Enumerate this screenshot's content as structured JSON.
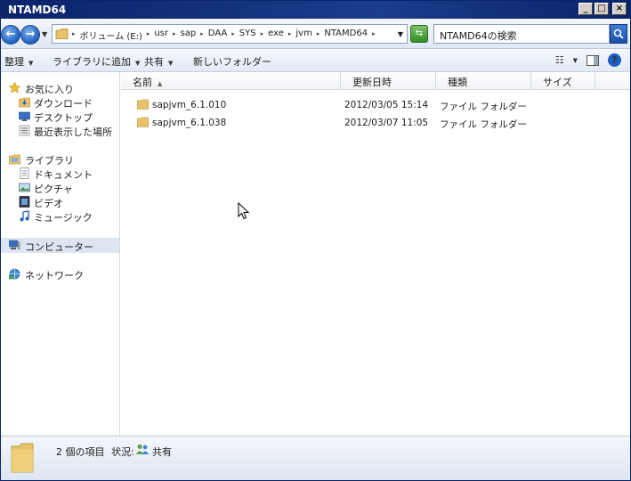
{
  "window": {
    "title": "NTAMD64",
    "minimize": "_",
    "maximize": "□",
    "close": "×"
  },
  "address": {
    "crumbs": [
      "ボリューム (E:)",
      "usr",
      "sap",
      "DAA",
      "SYS",
      "exe",
      "jvm",
      "NTAMD64"
    ],
    "search_value": "NTAMD64の検索"
  },
  "toolbar": {
    "organize": "整理",
    "add_to_library": "ライブラリに追加",
    "share": "共有",
    "new_folder": "新しいフォルダー"
  },
  "sidebar": {
    "favorites": "お気に入り",
    "downloads": "ダウンロード",
    "desktop": "デスクトップ",
    "recent": "最近表示した場所",
    "libraries": "ライブラリ",
    "documents": "ドキュメント",
    "pictures": "ピクチャ",
    "videos": "ビデオ",
    "music": "ミュージック",
    "computer": "コンピューター",
    "network": "ネットワーク"
  },
  "columns": {
    "name": "名前",
    "modified": "更新日時",
    "type": "種類",
    "size": "サイズ"
  },
  "files": [
    {
      "name": "sapjvm_6.1.010",
      "modified": "2012/03/05 15:14",
      "type": "ファイル フォルダー"
    },
    {
      "name": "sapjvm_6.1.038",
      "modified": "2012/03/07 11:05",
      "type": "ファイル フォルダー"
    }
  ],
  "status": {
    "count": "2 個の項目",
    "state_label": "状況:",
    "state_value": "共有"
  },
  "colors": {
    "title_bar": "#0a246a",
    "folder": "#e8c36a",
    "selection": "#dde5f0"
  }
}
